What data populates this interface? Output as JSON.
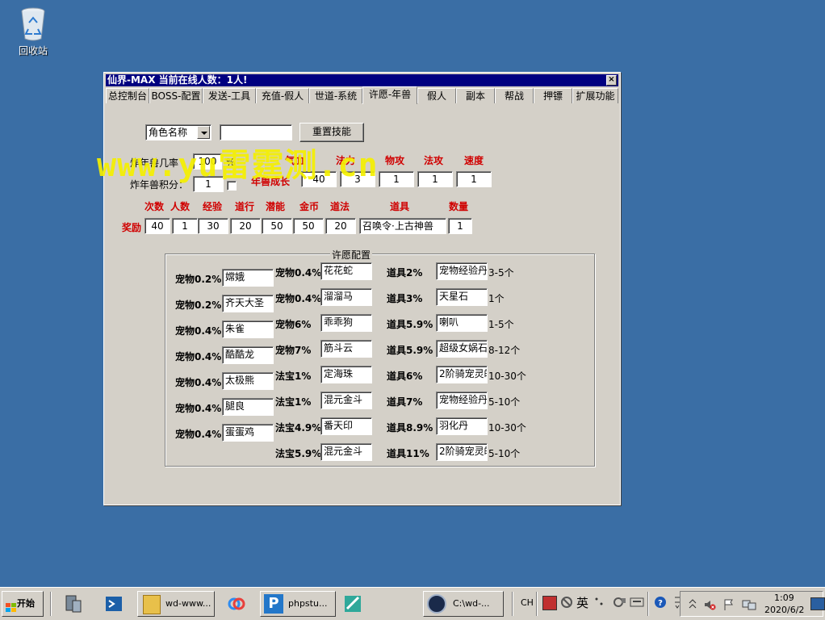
{
  "desktop": {
    "recycle_bin_label": "回收站",
    "background_color": "#3a6ea5"
  },
  "window": {
    "title": "仙界-MAX  当前在线人数：1人!",
    "close_glyph": "×",
    "tabs": [
      "总控制台",
      "BOSS-配置",
      "发送-工具",
      "充值-假人",
      "世道-系统",
      "许愿-年兽",
      "假人",
      "副本",
      "帮战",
      "押镖",
      "扩展功能"
    ],
    "active_tab": "许愿-年兽"
  },
  "top_controls": {
    "role_select_value": "角色名称",
    "role_input_value": "",
    "reset_skill_button": "重置技能",
    "bomb_rate_label": "炸年兽几率",
    "bomb_rate_value": "100",
    "bomb_rate_unit": "%",
    "bomb_points_label": "炸年兽积分：",
    "bomb_points_value": "1",
    "growth_label": "年兽成长",
    "growth_headers": [
      "气血",
      "法力",
      "物攻",
      "法攻",
      "速度"
    ],
    "growth_values": [
      "40",
      "3",
      "1",
      "1",
      "1"
    ]
  },
  "reward": {
    "label": "奖励",
    "headers": [
      "次数",
      "人数",
      "经验",
      "道行",
      "潜能",
      "金币",
      "道法",
      "道具",
      "数量"
    ],
    "values": [
      "40",
      "1",
      "30",
      "20",
      "50",
      "50",
      "20",
      "召唤令·上古神兽",
      "1"
    ]
  },
  "wish_config": {
    "title": "许愿配置",
    "col1": [
      {
        "label": "宠物0.2%",
        "value": "嫦娥"
      },
      {
        "label": "宠物0.2%",
        "value": "齐天大圣"
      },
      {
        "label": "宠物0.4%",
        "value": "朱雀"
      },
      {
        "label": "宠物0.4%",
        "value": "酷酷龙"
      },
      {
        "label": "宠物0.4%",
        "value": "太极熊"
      },
      {
        "label": "宠物0.4%",
        "value": "腿良"
      },
      {
        "label": "宠物0.4%",
        "value": "蛋蛋鸡"
      }
    ],
    "col2": [
      {
        "label": "宠物0.4%",
        "value": "花花蛇"
      },
      {
        "label": "宠物0.4%",
        "value": "溜溜马"
      },
      {
        "label": "宠物6%",
        "value": "乖乖狗"
      },
      {
        "label": "宠物7%",
        "value": "筋斗云"
      },
      {
        "label": "法宝1%",
        "value": "定海珠"
      },
      {
        "label": "法宝1%",
        "value": "混元金斗"
      },
      {
        "label": "法宝4.9%",
        "value": "番天印"
      },
      {
        "label": "法宝5.9%",
        "value": "混元金斗"
      }
    ],
    "col3": [
      {
        "label": "道具2%",
        "value": "宠物经验丹",
        "qty": "3-5个"
      },
      {
        "label": "道具3%",
        "value": "天星石",
        "qty": "1个"
      },
      {
        "label": "道具5.9%",
        "value": "喇叭",
        "qty": "1-5个"
      },
      {
        "label": "道具5.9%",
        "value": "超级女娲石",
        "qty": "8-12个"
      },
      {
        "label": "道具6%",
        "value": "2阶骑宠灵魄",
        "qty": "10-30个"
      },
      {
        "label": "道具7%",
        "value": "宠物经验丹",
        "qty": "5-10个"
      },
      {
        "label": "道具8.9%",
        "value": "羽化丹",
        "qty": "10-30个"
      },
      {
        "label": "道具11%",
        "value": "2阶骑宠灵魄",
        "qty": "5-10个"
      }
    ]
  },
  "watermark": "www.yu雷霆测.cn",
  "taskbar": {
    "start_label": "开始",
    "buttons": [
      {
        "label": "wd-www..."
      },
      {
        "label": "phpstu..."
      },
      {
        "label": "C:\\wd-..."
      }
    ],
    "tray": {
      "ime": "CH",
      "lang": "英",
      "time": "1:09",
      "date": "2020/6/2"
    }
  }
}
